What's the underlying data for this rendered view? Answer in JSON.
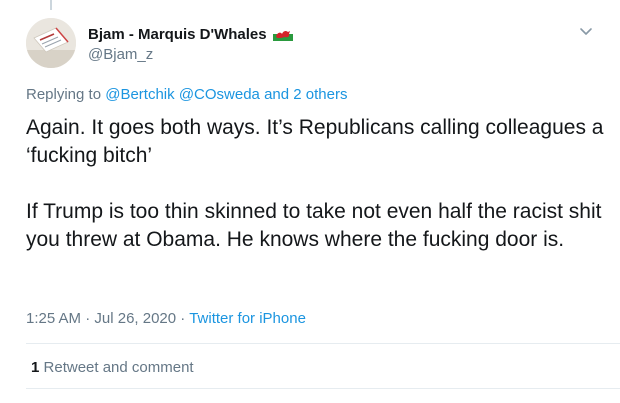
{
  "author": {
    "display_name": "Bjam - Marquis D'Whales",
    "handle": "@Bjam_z",
    "flag_icon": "wales-flag-icon",
    "avatar_icon": "avatar-image"
  },
  "reply_context": {
    "prefix": "Replying to",
    "mention_1": "@Bertchik",
    "mention_2": "@COsweda",
    "joiner": "and",
    "others": "2 others"
  },
  "tweet": {
    "paragraph_1": "Again. It goes both ways. It’s Republicans calling colleagues a ‘fucking bitch’",
    "paragraph_2": "If Trump is too thin skinned to take not even half the racist shit you threw at Obama. He knows where the fucking door is."
  },
  "meta": {
    "time": "1:25 AM",
    "separator": "·",
    "date": "Jul 26, 2020",
    "source": "Twitter for iPhone"
  },
  "stats": {
    "retweet_count": "1",
    "retweet_label": "Retweet and comment"
  },
  "colors": {
    "accent": "#1b95e0",
    "secondary_text": "#657786",
    "divider": "#e6ecf0"
  },
  "icons": {
    "menu": "chevron-down-icon"
  }
}
